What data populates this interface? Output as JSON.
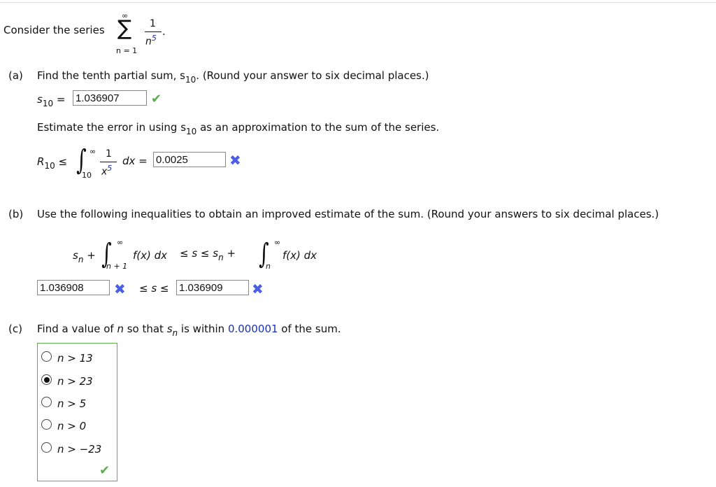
{
  "intro": {
    "text": "Consider the series",
    "sum_upper": "∞",
    "sum_lower": "n = 1",
    "numerator": "1",
    "denominator_base": "n",
    "denominator_exp": "5"
  },
  "part_a": {
    "label": "(a)",
    "question": "Find the tenth partial sum, s",
    "question_sub": "10",
    "question_tail": ". (Round your answer to six decimal places.)",
    "s10_label": "s",
    "s10_sub": "10",
    "s10_value": "1.036907",
    "s10_status": "correct",
    "error_text": "Estimate the error in using s",
    "error_sub": "10",
    "error_tail": "as an approximation to the sum of the series.",
    "R_label": "R",
    "R_sub": "10",
    "integral_upper": "∞",
    "integral_lower": "10",
    "int_num": "1",
    "int_den": "x",
    "int_exp": "5",
    "dx": "dx =",
    "R_value": "0.0025",
    "R_status": "incorrect"
  },
  "part_b": {
    "label": "(b)",
    "question": "Use the following inequalities to obtain an improved estimate of the sum. (Round your answers to six decimal places.)",
    "lower_integral_lower": "n + 1",
    "upper_integral_lower": "n",
    "fx": "f(x) dx",
    "lower_value": "1.036908",
    "upper_value": "1.036909",
    "lower_status": "incorrect",
    "upper_status": "incorrect",
    "middle": "≤ s ≤"
  },
  "part_c": {
    "label": "(c)",
    "question": "Find a value of n so that s",
    "question_sub": "n",
    "question_mid": "is within",
    "tolerance": "0.000001",
    "question_tail": "of the sum.",
    "options": [
      "n > 13",
      "n > 23",
      "n > 5",
      "n > 0",
      "n > −23"
    ],
    "selected_index": 1,
    "status": "correct"
  },
  "colors": {
    "correct": "#5cae4e",
    "incorrect": "#4a5ee8",
    "highlight": "#1a2fbb"
  }
}
